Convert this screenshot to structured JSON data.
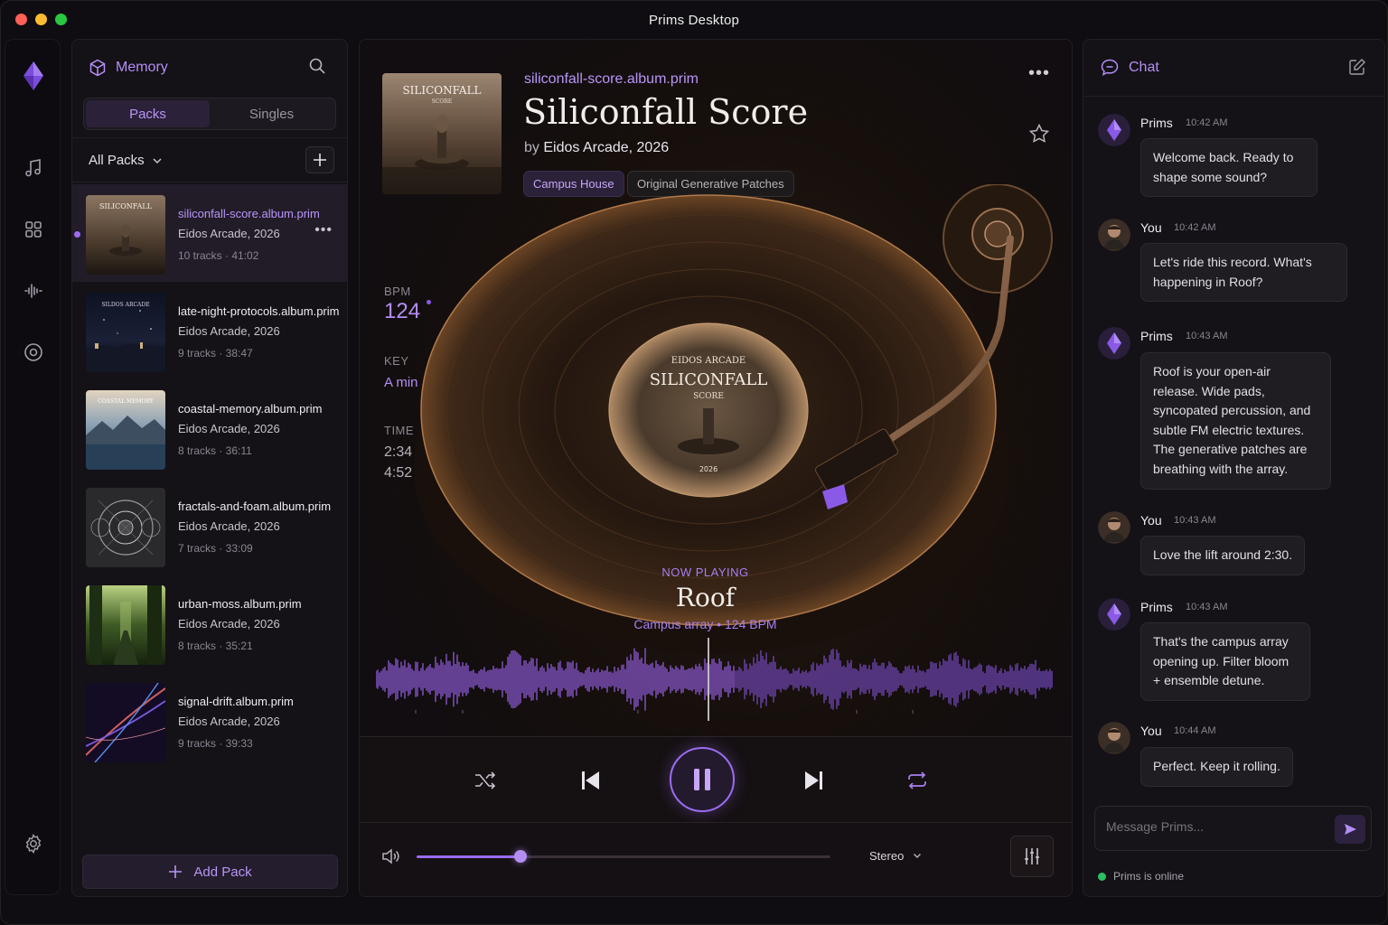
{
  "window": {
    "title": "Prims Desktop"
  },
  "rail": {
    "items": [
      {
        "icon": "prims-logo-icon"
      },
      {
        "icon": "music-note-icon"
      },
      {
        "icon": "grid-icon"
      },
      {
        "icon": "waveform-icon"
      },
      {
        "icon": "target-icon"
      },
      {
        "icon": "gear-icon"
      }
    ]
  },
  "memory": {
    "title": "Memory",
    "tabs": [
      "Packs",
      "Singles"
    ],
    "active_tab": "Packs",
    "filter": "All Packs",
    "add_pack": "Add Pack",
    "packs": [
      {
        "name": "siliconfall-score.album.prim",
        "artist": "Eidos Arcade, 2026",
        "meta": "10 tracks · 41:02",
        "selected": true
      },
      {
        "name": "late-night-protocols.album.prim",
        "artist": "Eidos Arcade, 2026",
        "meta": "9 tracks · 38:47"
      },
      {
        "name": "coastal-memory.album.prim",
        "artist": "Eidos Arcade, 2026",
        "meta": "8 tracks · 36:11"
      },
      {
        "name": "fractals-and-foam.album.prim",
        "artist": "Eidos Arcade, 2026",
        "meta": "7 tracks · 33:09"
      },
      {
        "name": "urban-moss.album.prim",
        "artist": "Eidos Arcade, 2026",
        "meta": "8 tracks · 35:21"
      },
      {
        "name": "signal-drift.album.prim",
        "artist": "Eidos Arcade, 2026",
        "meta": "9 tracks · 39:33"
      }
    ],
    "thumb_texts": [
      "SILICONFALL",
      "SILDOS ARCADE",
      "COASTAL MEMORY"
    ]
  },
  "album": {
    "filename": "siliconfall-score.album.prim",
    "title": "Siliconfall Score",
    "by": "by",
    "artist_year": "Eidos Arcade, 2026",
    "tags": [
      "Campus House",
      "Original Generative Patches"
    ],
    "cover_title": "SILICONFALL",
    "cover_sub": "SCORE",
    "label_top": "EIDOS ARCADE",
    "label_title": "SILICONFALL",
    "label_sub": "SCORE",
    "label_year": "2026"
  },
  "stats": {
    "bpm_label": "BPM",
    "bpm": "124",
    "key_label": "KEY",
    "key": "A min",
    "time_label": "TIME",
    "elapsed": "2:34",
    "total": "4:52"
  },
  "now_playing": {
    "label": "NOW PLAYING",
    "track": "Roof",
    "sub": "Campus array • 124 BPM",
    "progress": 0.53
  },
  "transport": {
    "state": "playing",
    "volume": 0.25,
    "output": "Stereo"
  },
  "chat": {
    "title": "Chat",
    "messages": [
      {
        "who": "Prims",
        "time": "10:42 AM",
        "text": "Welcome back. Ready to shape some sound?",
        "bot": true
      },
      {
        "who": "You",
        "time": "10:42 AM",
        "text": "Let's ride this record. What's happening in Roof?",
        "bot": false
      },
      {
        "who": "Prims",
        "time": "10:43 AM",
        "text": "Roof is your open-air release. Wide pads, syncopated percussion, and subtle FM electric textures. The generative patches are breathing with the array.",
        "bot": true
      },
      {
        "who": "You",
        "time": "10:43 AM",
        "text": "Love the lift around 2:30.",
        "bot": false
      },
      {
        "who": "Prims",
        "time": "10:43 AM",
        "text": "That's the campus array opening up. Filter bloom + ensemble detune.",
        "bot": true
      },
      {
        "who": "You",
        "time": "10:44 AM",
        "text": "Perfect. Keep it rolling.",
        "bot": false
      }
    ],
    "placeholder": "Message Prims...",
    "status": "Prims is online"
  },
  "colors": {
    "accent": "#b48ef5",
    "accent_dark": "#2b2138",
    "online": "#2cc060",
    "copper": "#b07a4a"
  }
}
